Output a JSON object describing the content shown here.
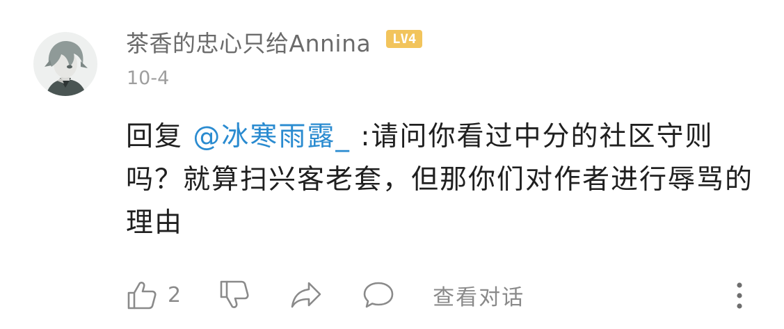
{
  "comment": {
    "username": "茶香的忠心只给Annina",
    "level_badge": "LV4",
    "date": "10-4",
    "reply_prefix": "回复 ",
    "mention": "@冰寒雨露_",
    "reply_text": " :请问你看过中分的社区守则吗？就算扫兴客老套，但那你们对作者进行辱骂的理由",
    "like_count": "2",
    "view_dialog_label": "查看对话"
  },
  "colors": {
    "username": "#6b6b6b",
    "date": "#9e9e9e",
    "mention": "#2a8bd0",
    "level_badge": "#f2c45c",
    "icon": "#8a8a8a"
  },
  "icons": {
    "avatar": "anime-character-avatar",
    "like": "thumbs-up-icon",
    "dislike": "thumbs-down-icon",
    "share": "share-arrow-icon",
    "reply": "comment-bubble-icon",
    "more": "vertical-dots-icon"
  }
}
